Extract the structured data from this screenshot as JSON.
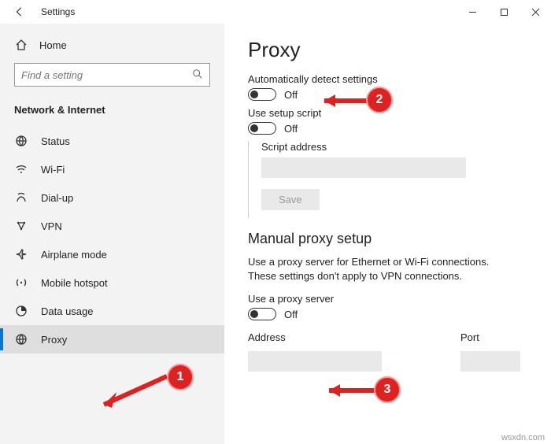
{
  "window": {
    "title": "Settings",
    "min": "—",
    "max": "▢",
    "close": "✕",
    "back": "←"
  },
  "sidebar": {
    "home": "Home",
    "search_placeholder": "Find a setting",
    "group": "Network & Internet",
    "items": [
      {
        "label": "Status"
      },
      {
        "label": "Wi-Fi"
      },
      {
        "label": "Dial-up"
      },
      {
        "label": "VPN"
      },
      {
        "label": "Airplane mode"
      },
      {
        "label": "Mobile hotspot"
      },
      {
        "label": "Data usage"
      },
      {
        "label": "Proxy"
      }
    ]
  },
  "main": {
    "title": "Proxy",
    "auto_detect_label": "Automatically detect settings",
    "auto_detect_state": "Off",
    "use_script_label": "Use setup script",
    "use_script_state": "Off",
    "script_address_label": "Script address",
    "save_label": "Save",
    "manual_title": "Manual proxy setup",
    "manual_desc": "Use a proxy server for Ethernet or Wi-Fi connections. These settings don't apply to VPN connections.",
    "use_proxy_label": "Use a proxy server",
    "use_proxy_state": "Off",
    "address_label": "Address",
    "port_label": "Port"
  },
  "annotations": {
    "b1": "1",
    "b2": "2",
    "b3": "3"
  },
  "watermark": "wsxdn.com"
}
